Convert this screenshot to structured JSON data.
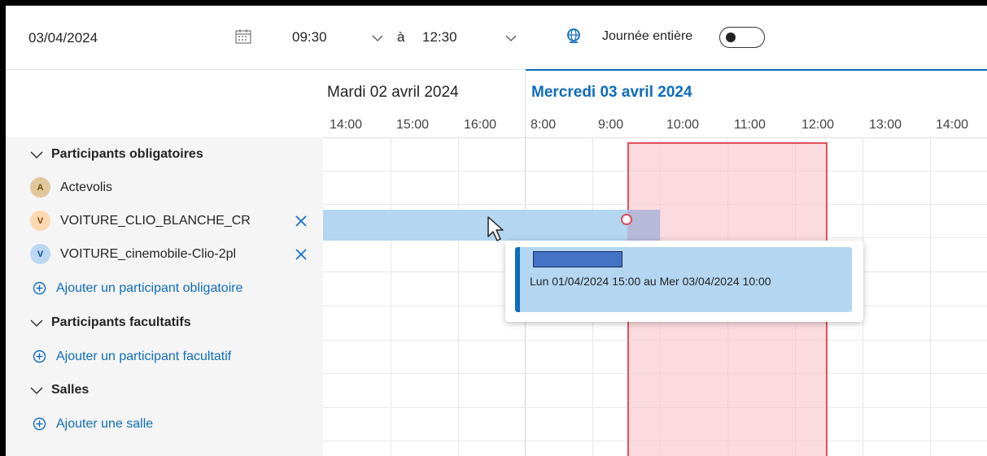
{
  "scheduler": {
    "date": "03/04/2024",
    "start_time": "09:30",
    "separator": "à",
    "end_time": "12:30",
    "all_day_label": "Journée entière",
    "all_day_on": false
  },
  "timeline": {
    "prev_day_label": "Mardi 02 avril 2024",
    "current_day_label": "Mercredi 03 avril 2024",
    "hours": [
      "14:00",
      "15:00",
      "16:00",
      "8:00",
      "9:00",
      "10:00",
      "11:00",
      "12:00",
      "13:00",
      "14:00"
    ]
  },
  "sidebar": {
    "required_section": "Participants obligatoires",
    "participants": [
      {
        "initial": "A",
        "name": "Actevolis",
        "removable": false
      },
      {
        "initial": "V",
        "name": "VOITURE_CLIO_BLANCHE_CR",
        "removable": true
      },
      {
        "initial": "V",
        "name": "VOITURE_cinemobile-Clio-2pl",
        "removable": true
      }
    ],
    "add_required": "Ajouter un participant obligatoire",
    "optional_section": "Participants facultatifs",
    "add_optional": "Ajouter un participant facultatif",
    "rooms_section": "Salles",
    "add_room": "Ajouter une salle"
  },
  "tooltip": {
    "text": "Lun 01/04/2024 15:00 au Mer 03/04/2024 10:00"
  },
  "colors": {
    "accent": "#0f6cbd",
    "busy": "#b4d6f0",
    "meeting_fill": "#f7bdc4",
    "meeting_border": "#e0505c"
  },
  "icons": {
    "calendar": "calendar-icon",
    "timezone": "globe-icon",
    "remove": "close-icon",
    "add": "add-circle-icon",
    "collapse": "chevron-down-icon"
  }
}
